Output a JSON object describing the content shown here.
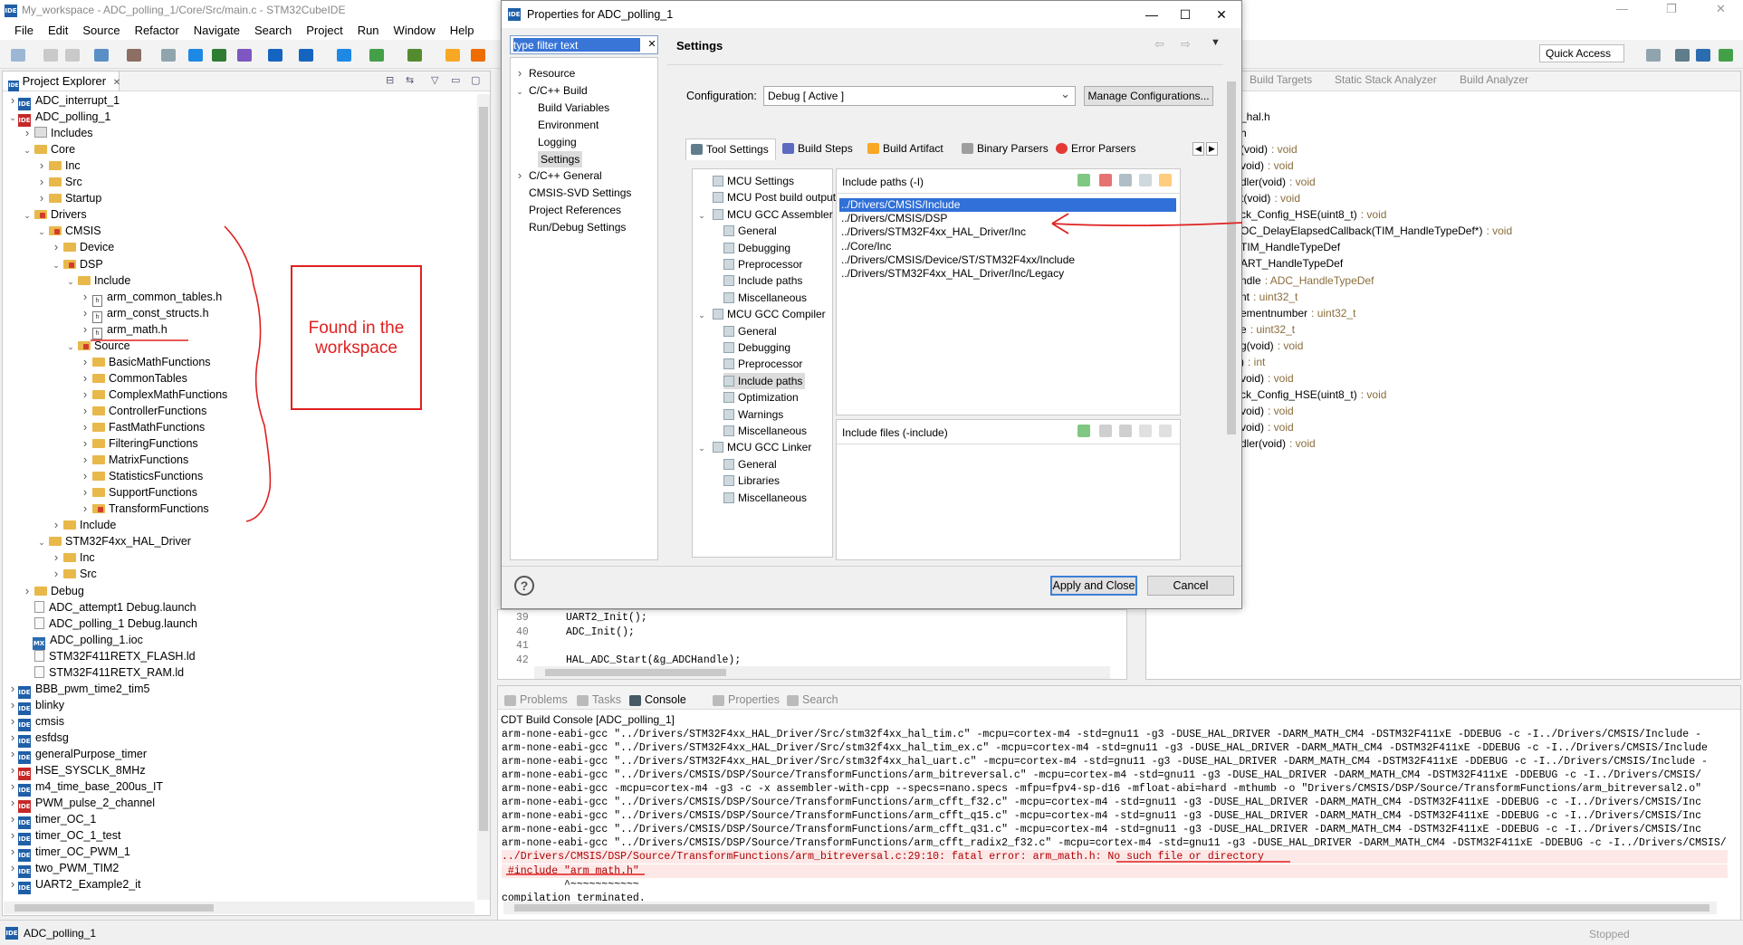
{
  "window": {
    "title": "My_workspace - ADC_polling_1/Core/Src/main.c - STM32CubeIDE",
    "menu": [
      "File",
      "Edit",
      "Source",
      "Refactor",
      "Navigate",
      "Search",
      "Project",
      "Run",
      "Window",
      "Help"
    ],
    "quick_access": "Quick Access"
  },
  "project_explorer": {
    "tab_label": "Project Explorer",
    "tree": [
      {
        "label": "ADC_interrupt_1",
        "kind": "ide",
        "indent": 0,
        "twisty": "closed"
      },
      {
        "label": "ADC_polling_1",
        "kind": "ide-red",
        "indent": 0,
        "twisty": "open"
      },
      {
        "label": "Includes",
        "kind": "inc",
        "indent": 1,
        "twisty": "closed"
      },
      {
        "label": "Core",
        "kind": "folder",
        "indent": 1,
        "twisty": "open"
      },
      {
        "label": "Inc",
        "kind": "folder",
        "indent": 2,
        "twisty": "closed"
      },
      {
        "label": "Src",
        "kind": "folder",
        "indent": 2,
        "twisty": "closed"
      },
      {
        "label": "Startup",
        "kind": "folder",
        "indent": 2,
        "twisty": "closed"
      },
      {
        "label": "Drivers",
        "kind": "folder-red",
        "indent": 1,
        "twisty": "open"
      },
      {
        "label": "CMSIS",
        "kind": "folder-red",
        "indent": 2,
        "twisty": "open"
      },
      {
        "label": "Device",
        "kind": "folder",
        "indent": 3,
        "twisty": "closed"
      },
      {
        "label": "DSP",
        "kind": "folder-red",
        "indent": 3,
        "twisty": "open"
      },
      {
        "label": "Include",
        "kind": "folder",
        "indent": 4,
        "twisty": "open"
      },
      {
        "label": "arm_common_tables.h",
        "kind": "h",
        "indent": 5,
        "twisty": "closed"
      },
      {
        "label": "arm_const_structs.h",
        "kind": "h",
        "indent": 5,
        "twisty": "closed"
      },
      {
        "label": "arm_math.h",
        "kind": "h",
        "indent": 5,
        "twisty": "closed"
      },
      {
        "label": "Source",
        "kind": "folder-red",
        "indent": 4,
        "twisty": "open"
      },
      {
        "label": "BasicMathFunctions",
        "kind": "folder",
        "indent": 5,
        "twisty": "closed"
      },
      {
        "label": "CommonTables",
        "kind": "folder",
        "indent": 5,
        "twisty": "closed"
      },
      {
        "label": "ComplexMathFunctions",
        "kind": "folder",
        "indent": 5,
        "twisty": "closed"
      },
      {
        "label": "ControllerFunctions",
        "kind": "folder",
        "indent": 5,
        "twisty": "closed"
      },
      {
        "label": "FastMathFunctions",
        "kind": "folder",
        "indent": 5,
        "twisty": "closed"
      },
      {
        "label": "FilteringFunctions",
        "kind": "folder",
        "indent": 5,
        "twisty": "closed"
      },
      {
        "label": "MatrixFunctions",
        "kind": "folder",
        "indent": 5,
        "twisty": "closed"
      },
      {
        "label": "StatisticsFunctions",
        "kind": "folder",
        "indent": 5,
        "twisty": "closed"
      },
      {
        "label": "SupportFunctions",
        "kind": "folder",
        "indent": 5,
        "twisty": "closed"
      },
      {
        "label": "TransformFunctions",
        "kind": "folder-red",
        "indent": 5,
        "twisty": "closed"
      },
      {
        "label": "Include",
        "kind": "folder",
        "indent": 3,
        "twisty": "closed"
      },
      {
        "label": "STM32F4xx_HAL_Driver",
        "kind": "folder",
        "indent": 2,
        "twisty": "open"
      },
      {
        "label": "Inc",
        "kind": "folder",
        "indent": 3,
        "twisty": "closed"
      },
      {
        "label": "Src",
        "kind": "folder",
        "indent": 3,
        "twisty": "closed"
      },
      {
        "label": "Debug",
        "kind": "folder",
        "indent": 1,
        "twisty": "closed"
      },
      {
        "label": "ADC_attempt1 Debug.launch",
        "kind": "doc",
        "indent": 1,
        "twisty": "none"
      },
      {
        "label": "ADC_polling_1 Debug.launch",
        "kind": "doc",
        "indent": 1,
        "twisty": "none"
      },
      {
        "label": "ADC_polling_1.ioc",
        "kind": "mx",
        "indent": 1,
        "twisty": "none"
      },
      {
        "label": "STM32F411RETX_FLASH.ld",
        "kind": "doc",
        "indent": 1,
        "twisty": "none"
      },
      {
        "label": "STM32F411RETX_RAM.ld",
        "kind": "doc",
        "indent": 1,
        "twisty": "none"
      },
      {
        "label": "BBB_pwm_time2_tim5",
        "kind": "ide",
        "indent": 0,
        "twisty": "closed"
      },
      {
        "label": "blinky",
        "kind": "ide",
        "indent": 0,
        "twisty": "closed"
      },
      {
        "label": "cmsis",
        "kind": "ide",
        "indent": 0,
        "twisty": "closed"
      },
      {
        "label": "esfdsg",
        "kind": "ide",
        "indent": 0,
        "twisty": "closed"
      },
      {
        "label": "generalPurpose_timer",
        "kind": "ide",
        "indent": 0,
        "twisty": "closed"
      },
      {
        "label": "HSE_SYSCLK_8MHz",
        "kind": "ide-red",
        "indent": 0,
        "twisty": "closed"
      },
      {
        "label": "m4_time_base_200us_IT",
        "kind": "ide",
        "indent": 0,
        "twisty": "closed"
      },
      {
        "label": "PWM_pulse_2_channel",
        "kind": "ide-red",
        "indent": 0,
        "twisty": "closed"
      },
      {
        "label": "timer_OC_1",
        "kind": "ide",
        "indent": 0,
        "twisty": "closed"
      },
      {
        "label": "timer_OC_1_test",
        "kind": "ide",
        "indent": 0,
        "twisty": "closed"
      },
      {
        "label": "timer_OC_PWM_1",
        "kind": "ide",
        "indent": 0,
        "twisty": "closed"
      },
      {
        "label": "two_PWM_TIM2",
        "kind": "ide",
        "indent": 0,
        "twisty": "closed"
      },
      {
        "label": "UART2_Example2_it",
        "kind": "ide",
        "indent": 0,
        "twisty": "closed"
      }
    ]
  },
  "annotation": {
    "text_line1": "Found in the",
    "text_line2": "workspace",
    "color": "#e02020"
  },
  "dialog": {
    "title": "Properties for ADC_polling_1",
    "filter_placeholder": "type filter text",
    "nav": [
      {
        "label": "Resource",
        "indent": 0,
        "twisty": "closed"
      },
      {
        "label": "C/C++ Build",
        "indent": 0,
        "twisty": "open"
      },
      {
        "label": "Build Variables",
        "indent": 1,
        "twisty": "none"
      },
      {
        "label": "Environment",
        "indent": 1,
        "twisty": "none"
      },
      {
        "label": "Logging",
        "indent": 1,
        "twisty": "none"
      },
      {
        "label": "Settings",
        "indent": 1,
        "twisty": "none",
        "selected": true
      },
      {
        "label": "C/C++ General",
        "indent": 0,
        "twisty": "closed"
      },
      {
        "label": "CMSIS-SVD Settings",
        "indent": 0,
        "twisty": "none"
      },
      {
        "label": "Project References",
        "indent": 0,
        "twisty": "none"
      },
      {
        "label": "Run/Debug Settings",
        "indent": 0,
        "twisty": "none"
      }
    ],
    "section_title": "Settings",
    "configuration_label": "Configuration:",
    "configuration_value": "Debug  [ Active ]",
    "manage_button": "Manage Configurations...",
    "tabs": [
      "Tool Settings",
      "Build Steps",
      "Build Artifact",
      "Binary Parsers",
      "Error Parsers"
    ],
    "tool_tree": [
      {
        "label": "MCU Settings",
        "indent": 0,
        "twisty": "none"
      },
      {
        "label": "MCU Post build outputs",
        "indent": 0,
        "twisty": "none"
      },
      {
        "label": "MCU GCC Assembler",
        "indent": 0,
        "twisty": "open"
      },
      {
        "label": "General",
        "indent": 1,
        "twisty": "none"
      },
      {
        "label": "Debugging",
        "indent": 1,
        "twisty": "none"
      },
      {
        "label": "Preprocessor",
        "indent": 1,
        "twisty": "none"
      },
      {
        "label": "Include paths",
        "indent": 1,
        "twisty": "none"
      },
      {
        "label": "Miscellaneous",
        "indent": 1,
        "twisty": "none"
      },
      {
        "label": "MCU GCC Compiler",
        "indent": 0,
        "twisty": "open"
      },
      {
        "label": "General",
        "indent": 1,
        "twisty": "none"
      },
      {
        "label": "Debugging",
        "indent": 1,
        "twisty": "none"
      },
      {
        "label": "Preprocessor",
        "indent": 1,
        "twisty": "none"
      },
      {
        "label": "Include paths",
        "indent": 1,
        "twisty": "none",
        "selected": true
      },
      {
        "label": "Optimization",
        "indent": 1,
        "twisty": "none"
      },
      {
        "label": "Warnings",
        "indent": 1,
        "twisty": "none"
      },
      {
        "label": "Miscellaneous",
        "indent": 1,
        "twisty": "none"
      },
      {
        "label": "MCU GCC Linker",
        "indent": 0,
        "twisty": "open"
      },
      {
        "label": "General",
        "indent": 1,
        "twisty": "none"
      },
      {
        "label": "Libraries",
        "indent": 1,
        "twisty": "none"
      },
      {
        "label": "Miscellaneous",
        "indent": 1,
        "twisty": "none"
      }
    ],
    "include_paths_title": "Include paths (-I)",
    "include_paths": [
      "../Drivers/CMSIS/Include",
      "../Drivers/CMSIS/DSP",
      "../Drivers/STM32F4xx_HAL_Driver/Inc",
      "../Core/Inc",
      "../Drivers/CMSIS/Device/ST/STM32F4xx/Include",
      "../Drivers/STM32F4xx_HAL_Driver/Inc/Legacy"
    ],
    "include_files_title": "Include files (-include)",
    "apply_button": "Apply and Close",
    "cancel_button": "Cancel"
  },
  "editor": {
    "lines": [
      {
        "no": "39",
        "code": "UART2_Init();"
      },
      {
        "no": "40",
        "code": "ADC_Init();"
      },
      {
        "no": "41",
        "code": ""
      },
      {
        "no": "42",
        "code": "HAL_ADC_Start(&g_ADCHandle);"
      }
    ]
  },
  "right_toolbar": {
    "items": [
      "Build Targets",
      "Static Stack Analyzer",
      "Build Analyzer"
    ]
  },
  "outline": {
    "items": [
      {
        "name": "_hal.h",
        "type": ""
      },
      {
        "name": "h",
        "type": ""
      },
      {
        "name": "(void)",
        "type": ": void"
      },
      {
        "name": "void)",
        "type": ": void"
      },
      {
        "name": "dler(void)",
        "type": ": void"
      },
      {
        "name": "t(void)",
        "type": ": void"
      },
      {
        "name": "ck_Config_HSE(uint8_t)",
        "type": ": void"
      },
      {
        "name": "OC_DelayElapsedCallback(TIM_HandleTypeDef*)",
        "type": ": void"
      },
      {
        "name": "TIM_HandleTypeDef",
        "type": ""
      },
      {
        "name": "ART_HandleTypeDef",
        "type": ""
      },
      {
        "name": "ndle",
        "type": ": ADC_HandleTypeDef"
      },
      {
        "name": "nt",
        "type": ": uint32_t"
      },
      {
        "name": "ementnumber",
        "type": ": uint32_t"
      },
      {
        "name": "e",
        "type": ": uint32_t"
      },
      {
        "name": "g(void)",
        "type": ": void"
      },
      {
        "name": ")",
        "type": ": int"
      },
      {
        "name": "void)",
        "type": ": void"
      },
      {
        "name": "ck_Config_HSE(uint8_t)",
        "type": ": void"
      },
      {
        "name": "void)",
        "type": ": void"
      },
      {
        "name": "void)",
        "type": ": void"
      },
      {
        "name": "dler(void)",
        "type": ": void"
      }
    ]
  },
  "console": {
    "tabs": [
      "Problems",
      "Tasks",
      "Console",
      "Properties",
      "Search"
    ],
    "active_tab": "Console",
    "header": "CDT Build Console [ADC_polling_1]",
    "lines": [
      {
        "text": "arm-none-eabi-gcc \"../Drivers/STM32F4xx_HAL_Driver/Src/stm32f4xx_hal_tim.c\" -mcpu=cortex-m4 -std=gnu11 -g3 -DUSE_HAL_DRIVER -DARM_MATH_CM4 -DSTM32F411xE -DDEBUG -c -I../Drivers/CMSIS/Include -",
        "err": false
      },
      {
        "text": "arm-none-eabi-gcc \"../Drivers/STM32F4xx_HAL_Driver/Src/stm32f4xx_hal_tim_ex.c\" -mcpu=cortex-m4 -std=gnu11 -g3 -DUSE_HAL_DRIVER -DARM_MATH_CM4 -DSTM32F411xE -DDEBUG -c -I../Drivers/CMSIS/Include",
        "err": false
      },
      {
        "text": "arm-none-eabi-gcc \"../Drivers/STM32F4xx_HAL_Driver/Src/stm32f4xx_hal_uart.c\" -mcpu=cortex-m4 -std=gnu11 -g3 -DUSE_HAL_DRIVER -DARM_MATH_CM4 -DSTM32F411xE -DDEBUG -c -I../Drivers/CMSIS/Include -",
        "err": false
      },
      {
        "text": "arm-none-eabi-gcc \"../Drivers/CMSIS/DSP/Source/TransformFunctions/arm_bitreversal.c\" -mcpu=cortex-m4 -std=gnu11 -g3 -DUSE_HAL_DRIVER -DARM_MATH_CM4 -DSTM32F411xE -DDEBUG -c -I../Drivers/CMSIS/",
        "err": false
      },
      {
        "text": "arm-none-eabi-gcc -mcpu=cortex-m4 -g3 -c -x assembler-with-cpp --specs=nano.specs -mfpu=fpv4-sp-d16 -mfloat-abi=hard -mthumb -o \"Drivers/CMSIS/DSP/Source/TransformFunctions/arm_bitreversal2.o\"",
        "err": false
      },
      {
        "text": "arm-none-eabi-gcc \"../Drivers/CMSIS/DSP/Source/TransformFunctions/arm_cfft_f32.c\" -mcpu=cortex-m4 -std=gnu11 -g3 -DUSE_HAL_DRIVER -DARM_MATH_CM4 -DSTM32F411xE -DDEBUG -c -I../Drivers/CMSIS/Inc",
        "err": false
      },
      {
        "text": "arm-none-eabi-gcc \"../Drivers/CMSIS/DSP/Source/TransformFunctions/arm_cfft_q15.c\" -mcpu=cortex-m4 -std=gnu11 -g3 -DUSE_HAL_DRIVER -DARM_MATH_CM4 -DSTM32F411xE -DDEBUG -c -I../Drivers/CMSIS/Inc",
        "err": false
      },
      {
        "text": "arm-none-eabi-gcc \"../Drivers/CMSIS/DSP/Source/TransformFunctions/arm_cfft_q31.c\" -mcpu=cortex-m4 -std=gnu11 -g3 -DUSE_HAL_DRIVER -DARM_MATH_CM4 -DSTM32F411xE -DDEBUG -c -I../Drivers/CMSIS/Inc",
        "err": false
      },
      {
        "text": "arm-none-eabi-gcc \"../Drivers/CMSIS/DSP/Source/TransformFunctions/arm_cfft_radix2_f32.c\" -mcpu=cortex-m4 -std=gnu11 -g3 -DUSE_HAL_DRIVER -DARM_MATH_CM4 -DSTM32F411xE -DDEBUG -c -I../Drivers/CMSIS/",
        "err": false
      },
      {
        "text": "../Drivers/CMSIS/DSP/Source/TransformFunctions/arm_bitreversal.c:29:10: fatal error: arm_math.h: No such file or directory",
        "err": true
      },
      {
        "text": " #include \"arm_math.h\"",
        "err": true
      },
      {
        "text": "          ^~~~~~~~~~~~",
        "err": false
      },
      {
        "text": "compilation terminated.",
        "err": false
      }
    ]
  },
  "status": {
    "selected_project": "ADC_polling_1",
    "state": "Stopped"
  }
}
